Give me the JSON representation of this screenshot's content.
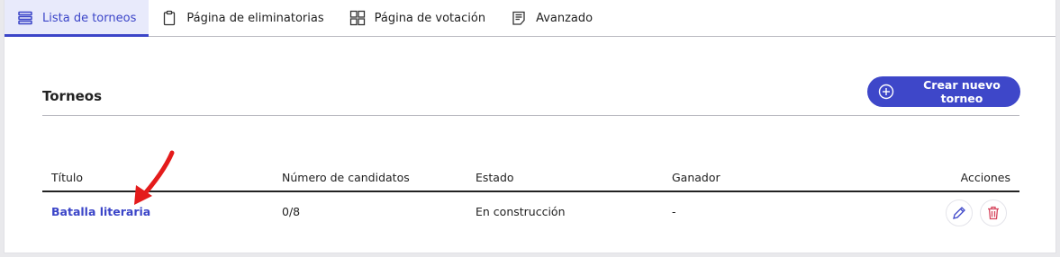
{
  "tabs": [
    {
      "label": "Lista de torneos",
      "icon": "list-icon",
      "active": true
    },
    {
      "label": "Página de eliminatorias",
      "icon": "clipboard-icon",
      "active": false
    },
    {
      "label": "Página de votación",
      "icon": "grid-icon",
      "active": false
    },
    {
      "label": "Avanzado",
      "icon": "document-icon",
      "active": false
    }
  ],
  "section": {
    "title": "Torneos",
    "new_button_label": "Crear nuevo torneo"
  },
  "table": {
    "headers": {
      "title": "Título",
      "candidates": "Número de candidatos",
      "status": "Estado",
      "winner": "Ganador",
      "actions": "Acciones"
    },
    "rows": [
      {
        "title": "Batalla literaria",
        "candidates": "0/8",
        "status": "En construcción",
        "winner": "-"
      }
    ]
  },
  "colors": {
    "accent": "#3e47c9",
    "danger": "#d6455d",
    "annotation": "#e41b1b"
  }
}
